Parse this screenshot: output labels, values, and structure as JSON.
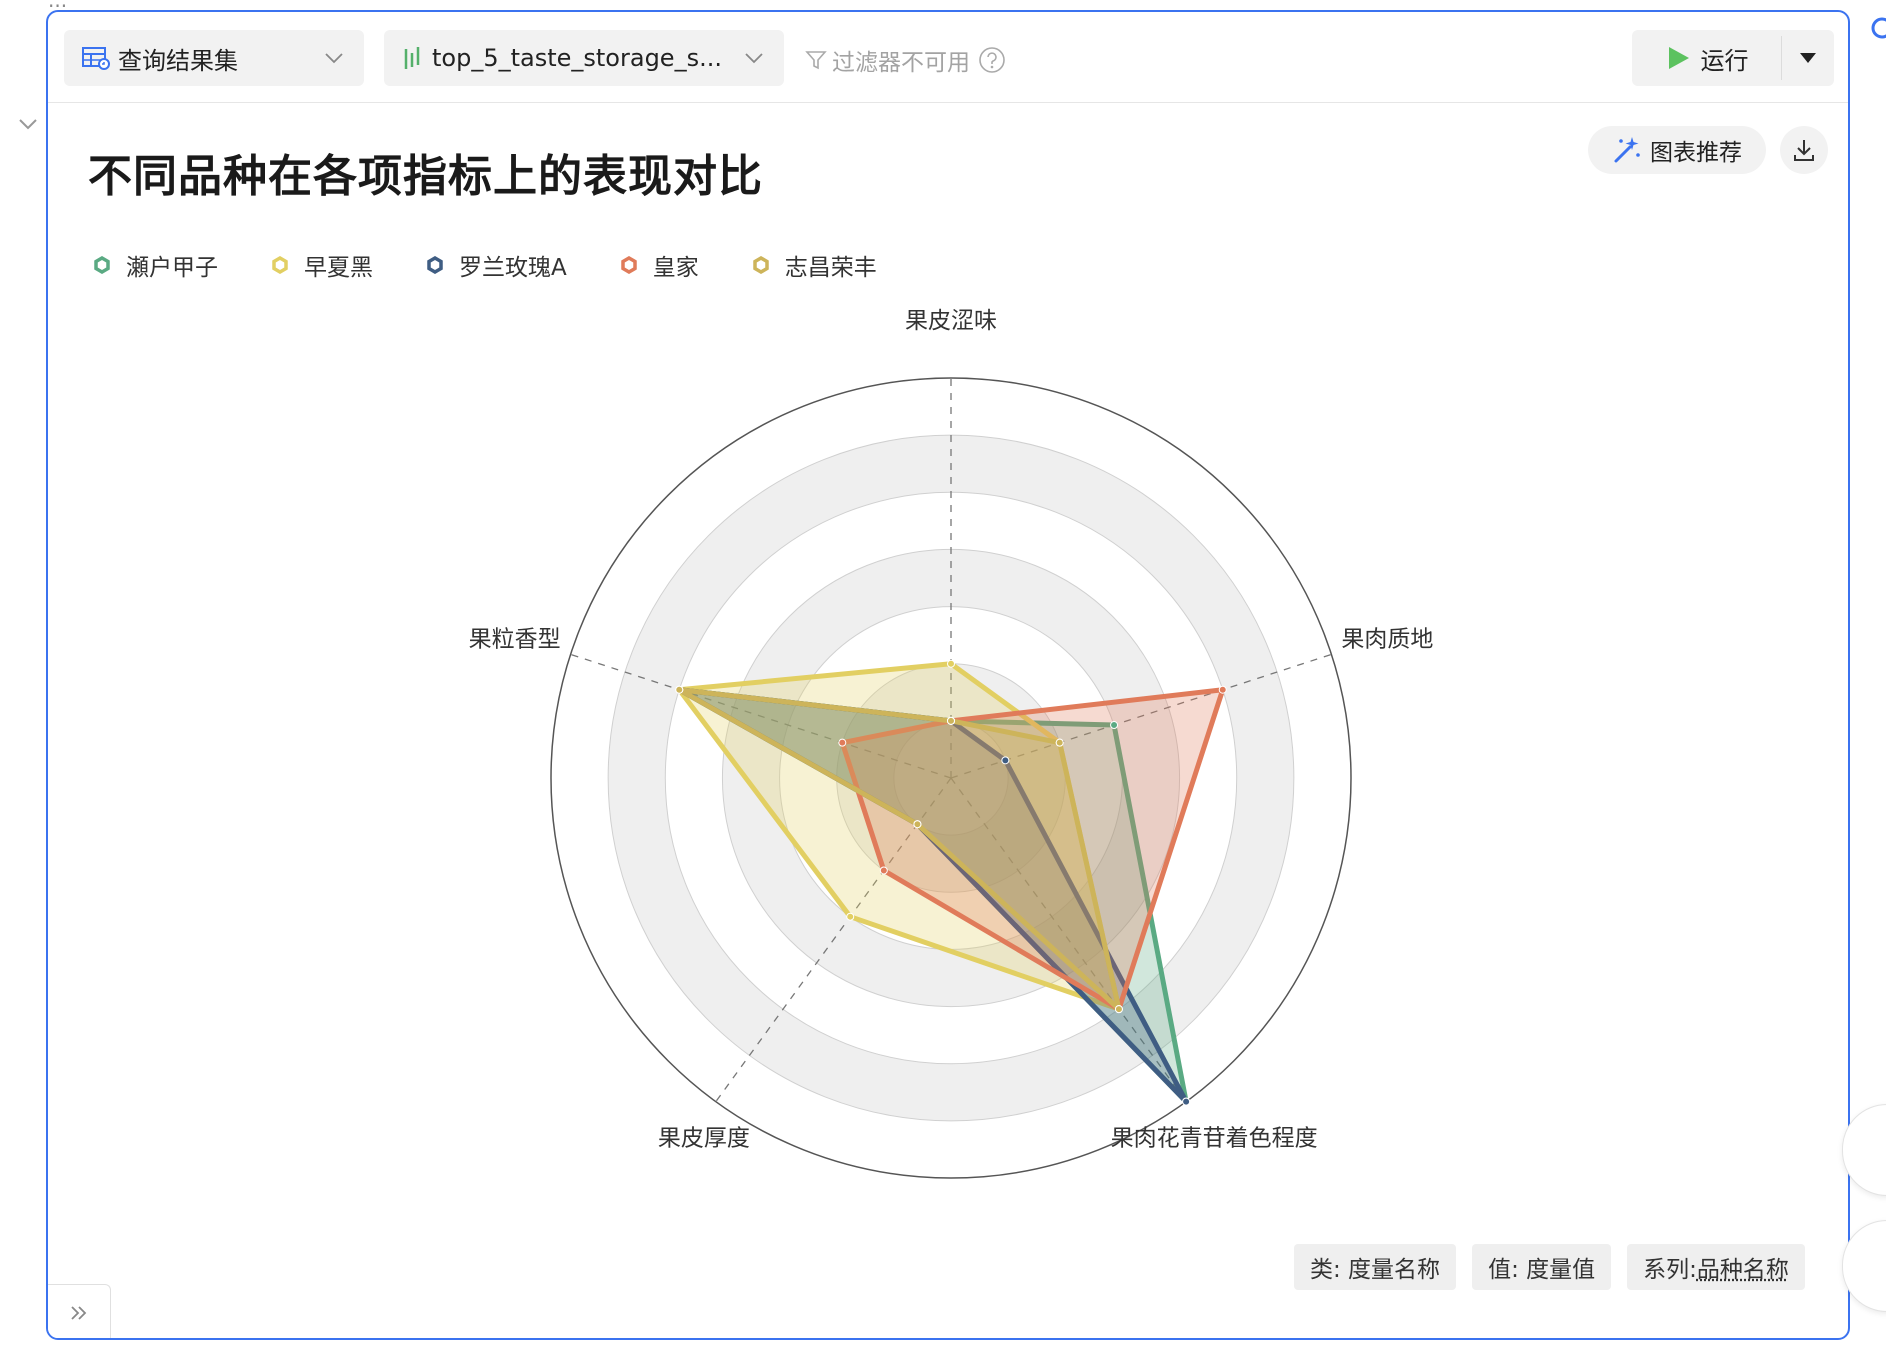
{
  "page": {
    "top_fragment": "...",
    "accent": "#3b73f0"
  },
  "toolbar": {
    "dataset_label": "查询结果集",
    "dataset_icon": "table-icon",
    "field_label": "top_5_taste_storage_s...",
    "field_icon": "bar-chart-icon",
    "filter_note": "过滤器不可用",
    "run_label": "运行"
  },
  "chart_header": {
    "recommend_label": "图表推荐",
    "recommend_icon": "magic-wand-icon",
    "download_icon": "download-icon"
  },
  "chart_data": {
    "type": "radar",
    "title": "不同品种在各项指标上的表现对比",
    "axes": [
      "果皮涩味",
      "果肉质地",
      "果肉花青苷着色程度",
      "果皮厚度",
      "果粒香型"
    ],
    "rmax": 7,
    "grid": true,
    "series": [
      {
        "name": "瀬户甲子",
        "color": "#5aaa83",
        "values": [
          1,
          3,
          7,
          1,
          5
        ]
      },
      {
        "name": "早夏黑",
        "color": "#e2cf62",
        "values": [
          2,
          2,
          5,
          3,
          5
        ]
      },
      {
        "name": "罗兰玫瑰A",
        "color": "#3f5d83",
        "values": [
          1,
          1,
          7,
          1,
          5
        ]
      },
      {
        "name": "皇家",
        "color": "#e07b5a",
        "values": [
          1,
          5,
          5,
          2,
          2
        ]
      },
      {
        "name": "志昌荣丰",
        "color": "#cdb45a",
        "values": [
          1,
          2,
          5,
          1,
          5
        ]
      }
    ]
  },
  "footer_tags": {
    "category": "类: 度量名称",
    "value": "值: 度量值",
    "series_prefix": "系列: ",
    "series_value": "品种名称"
  }
}
